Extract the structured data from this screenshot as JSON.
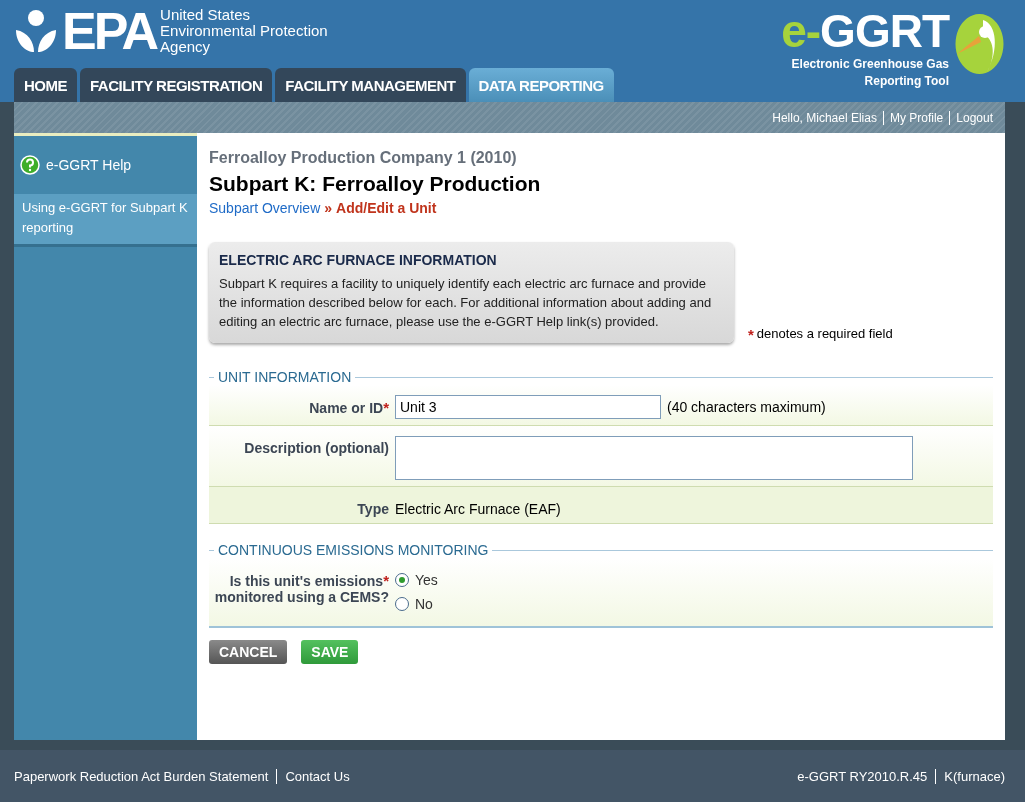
{
  "agency": {
    "mark": "EPA",
    "lines": [
      "United States",
      "Environmental Protection",
      "Agency"
    ]
  },
  "tool": {
    "prefix": "e-",
    "name": "GGRT",
    "subtitle": [
      "Electronic Greenhouse Gas",
      "Reporting Tool"
    ]
  },
  "tabs": [
    {
      "label": "HOME",
      "selected": false
    },
    {
      "label": "FACILITY REGISTRATION",
      "selected": false
    },
    {
      "label": "FACILITY MANAGEMENT",
      "selected": false
    },
    {
      "label": "DATA REPORTING",
      "selected": true
    }
  ],
  "user_links": [
    "Hello, Michael Elias",
    "My Profile",
    "Logout"
  ],
  "sidebar": {
    "help": "e-GGRT Help",
    "items": [
      {
        "label": "Using e-GGRT for Subpart K reporting",
        "selected": true
      }
    ]
  },
  "facility": "Ferroalloy Production Company 1 (2010)",
  "title": "Subpart K: Ferroalloy Production",
  "breadcrumb": {
    "link": "Subpart Overview",
    "separator": "»",
    "current": "Add/Edit a Unit"
  },
  "info_box": {
    "heading": "ELECTRIC ARC FURNACE INFORMATION",
    "text": "Subpart K requires a facility to uniquely identify each electric arc furnace and provide the information described below for each. For additional information about adding and editing an electric arc furnace, please use the e-GGRT Help link(s) provided."
  },
  "required_note": {
    "mark": "*",
    "text": "denotes a required field"
  },
  "unit_section": {
    "legend": "UNIT INFORMATION",
    "name_label": "Name or ID",
    "name_value": "Unit 3",
    "name_hint": "(40 characters maximum)",
    "description_label": "Description (optional)",
    "type_label": "Type",
    "type_value": "Electric Arc Furnace (EAF)"
  },
  "cems_section": {
    "legend": "CONTINUOUS EMISSIONS MONITORING",
    "question": [
      "Is this unit's emissions",
      "monitored using a CEMS?"
    ],
    "options": [
      {
        "label": "Yes",
        "selected": true
      },
      {
        "label": "No",
        "selected": false
      }
    ]
  },
  "buttons": [
    {
      "label": "CANCEL",
      "kind": "secondary"
    },
    {
      "label": "SAVE",
      "kind": "primary"
    }
  ],
  "footer": {
    "left": [
      "Paperwork Reduction Act Burden Statement",
      "Contact Us"
    ],
    "right": [
      "e-GGRT RY2010.R.45",
      "K(furnace)"
    ]
  }
}
